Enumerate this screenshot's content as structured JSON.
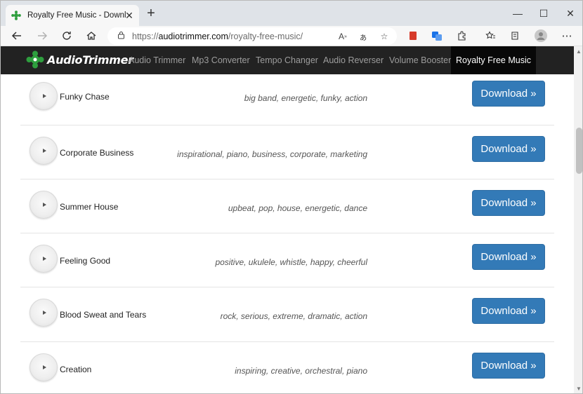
{
  "browser": {
    "tab_title": "Royalty Free Music - Download F",
    "new_tab_glyph": "+",
    "url_scheme": "https://",
    "url_host": "audiotrimmer.com",
    "url_path": "/royalty-free-music/",
    "window_controls": {
      "minimize": "—",
      "maximize": "☐",
      "close": "✕"
    }
  },
  "site": {
    "brand": "AudioTrimmer",
    "nav": [
      {
        "label": "Audio Trimmer",
        "active": false
      },
      {
        "label": "Mp3 Converter",
        "active": false
      },
      {
        "label": "Tempo Changer",
        "active": false
      },
      {
        "label": "Audio Reverser",
        "active": false
      },
      {
        "label": "Volume Booster",
        "active": false
      },
      {
        "label": "Royalty Free Music",
        "active": true
      }
    ]
  },
  "tracks": [
    {
      "title": "Funky Chase",
      "tags": "big band, energetic, funky, action",
      "download_label": "Download »"
    },
    {
      "title": "Corporate Business",
      "tags": "inspirational, piano, business, corporate, marketing",
      "download_label": "Download »"
    },
    {
      "title": "Summer House",
      "tags": "upbeat, pop, house, energetic, dance",
      "download_label": "Download »"
    },
    {
      "title": "Feeling Good",
      "tags": "positive, ukulele, whistle, happy, cheerful",
      "download_label": "Download »"
    },
    {
      "title": "Blood Sweat and Tears",
      "tags": "rock, serious, extreme, dramatic, action",
      "download_label": "Download »"
    },
    {
      "title": "Creation",
      "tags": "inspiring, creative, orchestral, piano",
      "download_label": "Download »"
    }
  ],
  "colors": {
    "nav_bg": "#222222",
    "nav_active_bg": "#080808",
    "download_button": "#337ab7",
    "brand_green": "#2e9e3e"
  }
}
